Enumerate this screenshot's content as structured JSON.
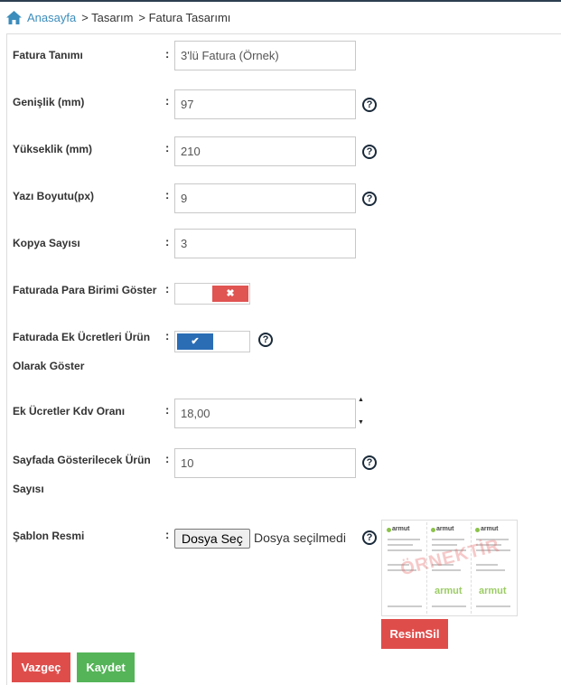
{
  "breadcrumb": {
    "home": "Anasayfa",
    "items": [
      "> Tasarım",
      "> Fatura Tasarımı"
    ]
  },
  "form": {
    "invoice_name": {
      "label": "Fatura Tanımı",
      "value": "3'lü Fatura (Örnek)"
    },
    "width": {
      "label": "Genişlik (mm)",
      "value": "97"
    },
    "height": {
      "label": "Yükseklik (mm)",
      "value": "210"
    },
    "font_size": {
      "label": "Yazı Boyutu(px)",
      "value": "9"
    },
    "copy_count": {
      "label": "Kopya Sayısı",
      "value": "3"
    },
    "show_currency": {
      "label": "Faturada Para Birimi Göster",
      "state": "off",
      "icon": "times-icon"
    },
    "extra_fees_as_product": {
      "label": "Faturada Ek Ücretleri Ürün Olarak Göster",
      "state": "on",
      "icon": "check-icon"
    },
    "extra_fees_vat": {
      "label": "Ek Ücretler Kdv Oranı",
      "value": "18,00"
    },
    "products_per_page": {
      "label": "Sayfada Gösterilecek Ürün Sayısı",
      "value": "10"
    },
    "template_image": {
      "label": "Şablon Resmi",
      "file_button": "Dosya Seç",
      "file_status": "Dosya seçilmedi",
      "watermark": "ÖRNEKTİR",
      "logo_text": "armut",
      "delete_button": "ResimSil"
    }
  },
  "colon": ":",
  "help": "?",
  "actions": {
    "cancel": "Vazgeç",
    "save": "Kaydet"
  },
  "colors": {
    "link": "#3c8dbc",
    "danger": "#df4d4b",
    "success": "#55b458",
    "toggle_on": "#2a6db5",
    "toggle_off": "#e05451"
  }
}
